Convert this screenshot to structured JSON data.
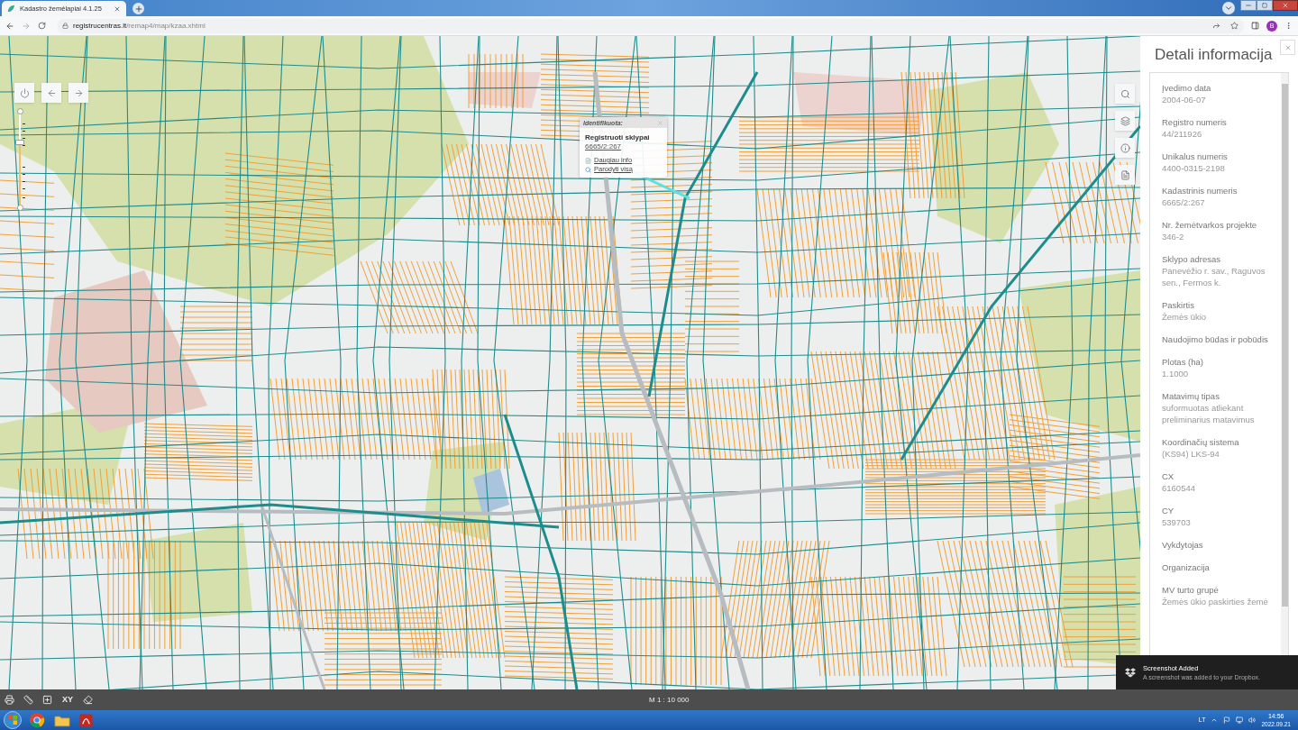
{
  "browser": {
    "tab": {
      "title": "Kadastro žemėlapiai 4.1.25"
    },
    "url": {
      "host": "registrucentras.lt",
      "path": "/remap4/map/kzaa.xhtml"
    },
    "profile_initial": "B"
  },
  "map": {
    "zoom_slider": {
      "level": 0.69
    },
    "popup": {
      "title": "Identifikuota:",
      "heading": "Registruoti sklypai",
      "parcel_link": "6665/2:267",
      "links": [
        {
          "label": "Daugiau info",
          "kind": "info"
        },
        {
          "label": "Parodyti visą",
          "kind": "search"
        }
      ]
    },
    "tools": [
      {
        "kind": "search"
      },
      {
        "kind": "layers"
      },
      {
        "kind": "info"
      },
      {
        "kind": "document"
      }
    ],
    "status_bar": {
      "tools": [
        {
          "kind": "print"
        },
        {
          "kind": "ruler"
        },
        {
          "kind": "select"
        },
        {
          "kind": "text",
          "label": "XY"
        },
        {
          "kind": "eraser"
        }
      ],
      "scale": "M 1 : 10 000"
    }
  },
  "panel": {
    "title": "Detali informacija",
    "fields": [
      {
        "label": "Įvedimo data",
        "value": "2004-06-07"
      },
      {
        "label": "Registro numeris",
        "value": "44/211926"
      },
      {
        "label": "Unikalus numeris",
        "value": "4400-0315-2198"
      },
      {
        "label": "Kadastrinis numeris",
        "value": "6665/2:267"
      },
      {
        "label": "Nr. žemėtvarkos projekte",
        "value": "346-2"
      },
      {
        "label": "Sklypo adresas",
        "value": "Panevėžio r. sav., Raguvos sen., Fermos k."
      },
      {
        "label": "Paskirtis",
        "value": "Žemės ūkio"
      },
      {
        "label": "Naudojimo būdas ir pobūdis"
      },
      {
        "label": "Plotas (ha)",
        "value": "1.1000"
      },
      {
        "label": "Matavimų tipas",
        "value": "suformuotas atliekant preliminarius matavimus"
      },
      {
        "label": "Koordinačių sistema",
        "value": "(KS94) LKS-94"
      },
      {
        "label": "CX",
        "value": "6160544"
      },
      {
        "label": "CY",
        "value": "539703"
      },
      {
        "label": "Vykdytojas"
      },
      {
        "label": "Organizacija"
      },
      {
        "label": "MV turto grupė",
        "value": "Žemės ūkio paskirties žemė"
      }
    ]
  },
  "notification": {
    "title": "Screenshot Added",
    "message": "A screenshot was added to your Dropbox."
  },
  "taskbar": {
    "language": "LT",
    "time": "14:56",
    "date": "2022.09.21"
  }
}
